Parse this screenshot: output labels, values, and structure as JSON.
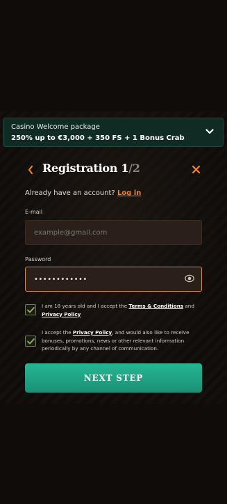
{
  "promo": {
    "title": "Casino Welcome package",
    "offer": "250% up to €3,000 + 350 FS + 1 Bonus Crab"
  },
  "registration": {
    "title": "Registration",
    "step_current": "1",
    "step_total": "/2",
    "have_account_text": "Already have an account?",
    "login_link": "Log in"
  },
  "form": {
    "email_label": "E-mail",
    "email_placeholder": "example@gmail.com",
    "email_value": "",
    "password_label": "Password",
    "password_value": "••••••••••••"
  },
  "consents": {
    "age_prefix": "I am 18 years old and I accept the ",
    "age_terms_link": "Terms & Conditions",
    "age_and": " and ",
    "age_privacy_link": "Privacy Policy",
    "marketing_prefix": "I accept the ",
    "marketing_privacy_link": "Privacy Policy",
    "marketing_rest": ", and would also like to receive bonuses, promotions, news or other relevant information periodically by any channel of communication."
  },
  "cta": {
    "label": "NEXT STEP"
  },
  "colors": {
    "accent_orange": "#f0842c",
    "accent_green": "#1fa686",
    "check_green": "#8fb84a"
  }
}
